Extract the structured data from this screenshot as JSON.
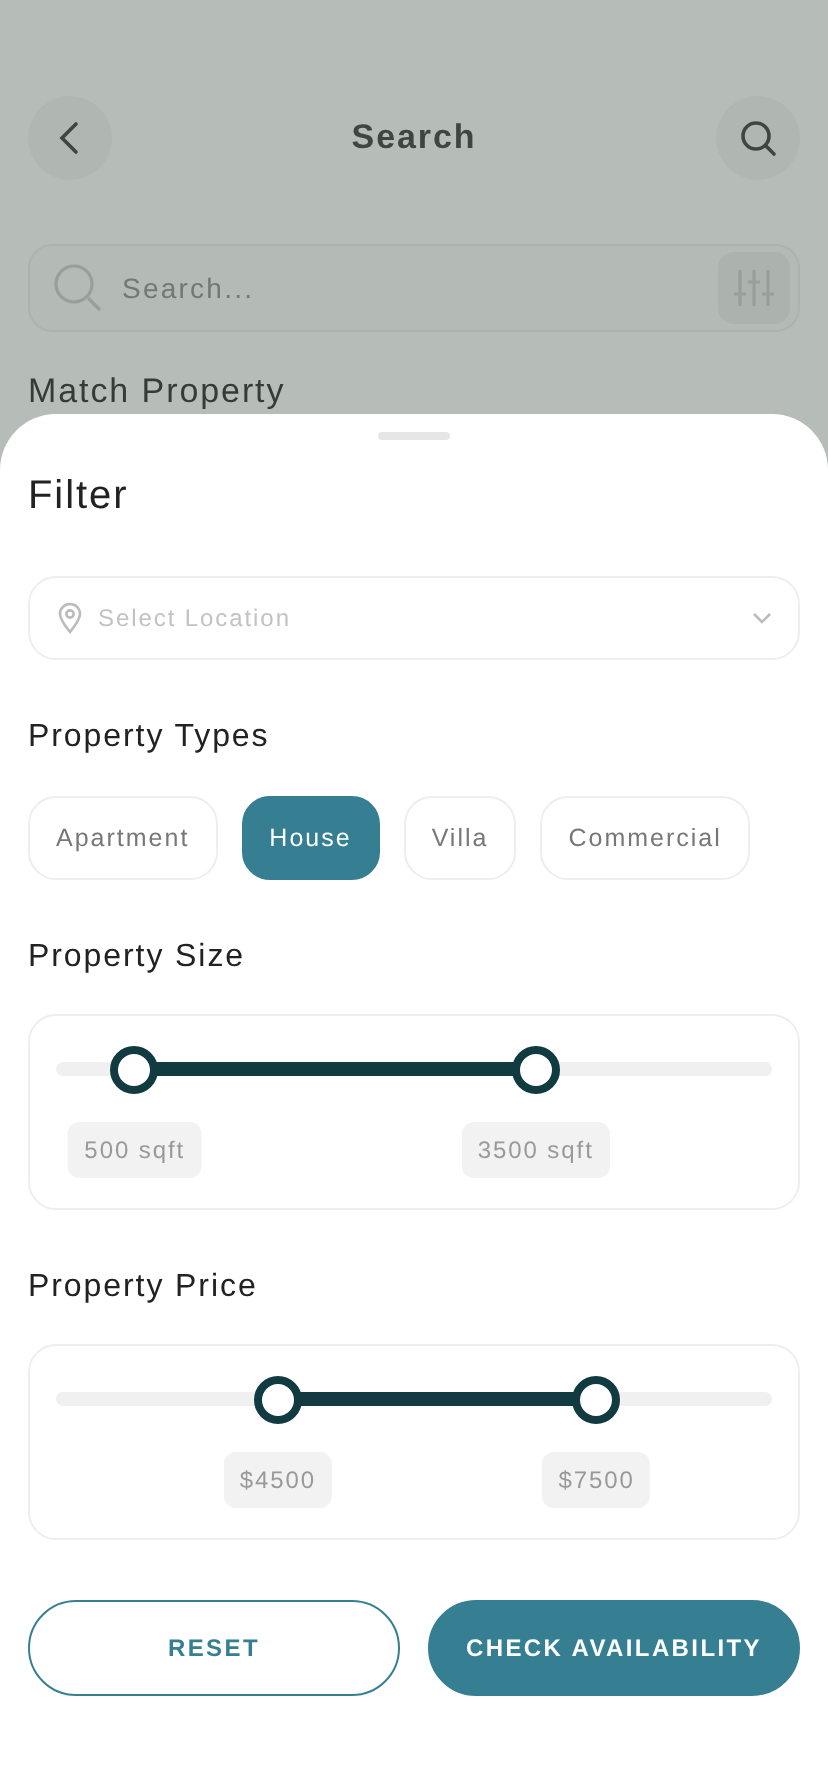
{
  "header": {
    "title": "Search"
  },
  "search": {
    "placeholder": "Search..."
  },
  "section_title": "Match Property",
  "filter": {
    "title": "Filter",
    "location": {
      "placeholder": "Select Location"
    },
    "types_title": "Property Types",
    "types": [
      {
        "label": "Apartment",
        "selected": false
      },
      {
        "label": "House",
        "selected": true
      },
      {
        "label": "Villa",
        "selected": false
      },
      {
        "label": "Commercial",
        "selected": false
      }
    ],
    "ranges": [
      {
        "title": "Property Size",
        "thumbs": [
          {
            "level": 0.11,
            "reading": "500 sqft"
          },
          {
            "level": 0.67,
            "reading": "3500 sqft"
          }
        ]
      },
      {
        "title": "Property Price",
        "thumbs": [
          {
            "level": 0.31,
            "reading": "$4500"
          },
          {
            "level": 0.755,
            "reading": "$7500"
          }
        ]
      }
    ],
    "buttons": [
      {
        "label": "RESET",
        "kind": "outline"
      },
      {
        "label": "CHECK AVAILABILITY",
        "kind": "primary"
      }
    ]
  }
}
